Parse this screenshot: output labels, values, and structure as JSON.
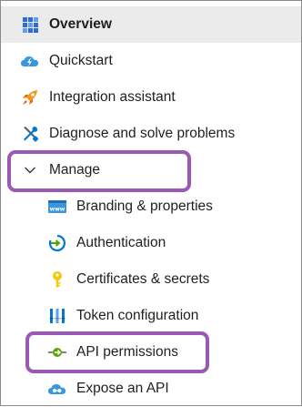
{
  "menu": {
    "overview": {
      "label": "Overview",
      "icon": "grid-icon"
    },
    "quickstart": {
      "label": "Quickstart",
      "icon": "cloud-lightning-icon"
    },
    "integration": {
      "label": "Integration assistant",
      "icon": "rocket-icon"
    },
    "diagnose": {
      "label": "Diagnose and solve problems",
      "icon": "wrench-screwdriver-icon"
    },
    "manage": {
      "label": "Manage",
      "icon": "chevron-down-icon"
    },
    "sub": {
      "branding": {
        "label": "Branding & properties",
        "icon": "www-window-icon"
      },
      "authentication": {
        "label": "Authentication",
        "icon": "auth-circle-arrow-icon"
      },
      "certificates": {
        "label": "Certificates & secrets",
        "icon": "key-icon"
      },
      "token": {
        "label": "Token configuration",
        "icon": "token-bars-icon"
      },
      "api_permissions": {
        "label": "API permissions",
        "icon": "api-arrow-icon"
      },
      "expose_api": {
        "label": "Expose an API",
        "icon": "cloud-api-icon"
      }
    }
  },
  "colors": {
    "highlight": "#9b59b6",
    "active_bg": "#ebebeb",
    "azure_blue": "#0078d4"
  }
}
